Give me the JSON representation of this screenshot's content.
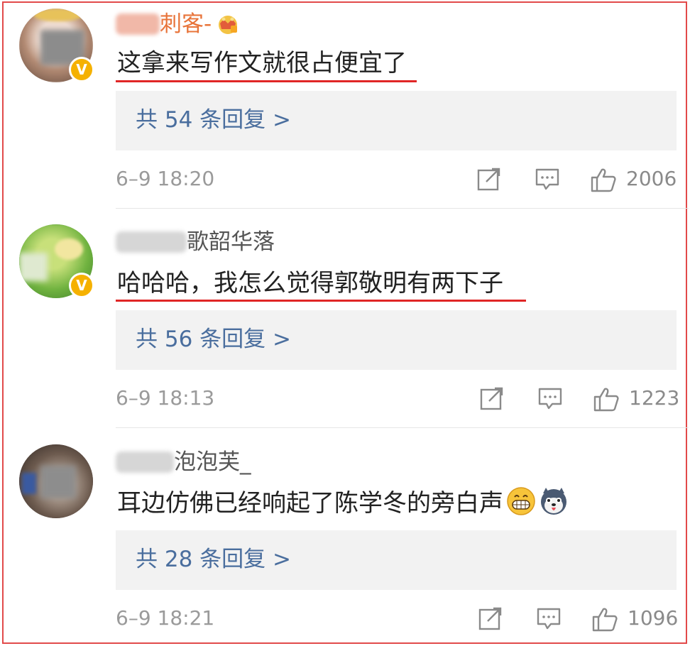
{
  "comments": [
    {
      "username": "刺客-",
      "text": "这拿来写作文就很占便宜了",
      "replies": "共 54 条回复 >",
      "time": "6–9 18:20",
      "likes": "2006",
      "icons": [
        "share-icon",
        "comment-icon",
        "like-icon"
      ]
    },
    {
      "username": "歌韶华落",
      "text": "哈哈哈，我怎么觉得郭敬明有两下子",
      "replies": "共 56 条回复 >",
      "time": "6–9 18:13",
      "likes": "1223",
      "icons": [
        "share-icon",
        "comment-icon",
        "like-icon"
      ]
    },
    {
      "username": "泡泡芙_",
      "text": "耳边仿佛已经响起了陈学冬的旁白声",
      "replies": "共 28 条回复 >",
      "time": "6–9 18:21",
      "likes": "1096",
      "icons": [
        "share-icon",
        "comment-icon",
        "like-icon",
        "grin-emoji-icon",
        "husky-emoji-icon"
      ]
    }
  ],
  "colors": {
    "frame_border": "#e24a4a",
    "highlight_underline": "#e02626",
    "vip_username": "#e8743a",
    "link_blue": "#4a6e9e",
    "verified_badge": "#f5b100"
  }
}
